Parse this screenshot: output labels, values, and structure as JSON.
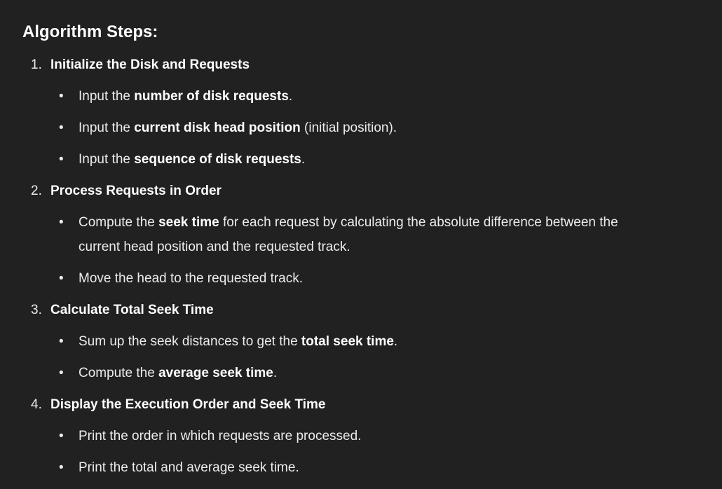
{
  "heading": "Algorithm Steps:",
  "steps": [
    {
      "number": "1.",
      "title": "Initialize the Disk and Requests",
      "bullets": [
        {
          "pre": "Input the ",
          "bold": "number of disk requests",
          "post": "."
        },
        {
          "pre": "Input the ",
          "bold": "current disk head position",
          "post": " (initial position)."
        },
        {
          "pre": "Input the ",
          "bold": "sequence of disk requests",
          "post": "."
        }
      ]
    },
    {
      "number": "2.",
      "title": "Process Requests in Order",
      "bullets": [
        {
          "pre": "Compute the ",
          "bold": "seek time",
          "post": " for each request by calculating the absolute difference between the current head position and the requested track."
        },
        {
          "pre": "Move the head to the requested track.",
          "bold": "",
          "post": ""
        }
      ]
    },
    {
      "number": "3.",
      "title": "Calculate Total Seek Time",
      "bullets": [
        {
          "pre": "Sum up the seek distances to get the ",
          "bold": "total seek time",
          "post": "."
        },
        {
          "pre": "Compute the ",
          "bold": "average seek time",
          "post": "."
        }
      ]
    },
    {
      "number": "4.",
      "title": "Display the Execution Order and Seek Time",
      "bullets": [
        {
          "pre": "Print the order in which requests are processed.",
          "bold": "",
          "post": ""
        },
        {
          "pre": "Print the total and average seek time.",
          "bold": "",
          "post": ""
        }
      ]
    }
  ]
}
